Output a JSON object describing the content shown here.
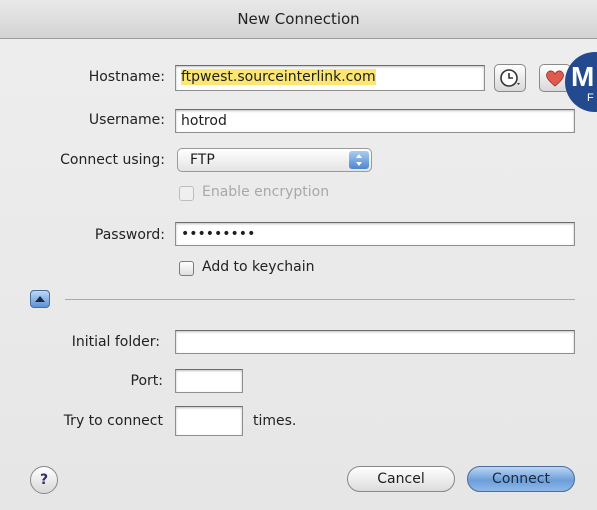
{
  "window": {
    "title": "New Connection"
  },
  "form": {
    "hostname_label": "Hostname:",
    "hostname_value": "ftpwest.sourceinterlink.com",
    "username_label": "Username:",
    "username_value": "hotrod",
    "connect_label": "Connect using:",
    "connect_value": "FTP",
    "encryption_label": "Enable encryption",
    "password_label": "Password:",
    "password_value": "•••••••••",
    "keychain_label": "Add to keychain",
    "initial_folder_label": "Initial folder:",
    "initial_folder_value": "",
    "port_label": "Port:",
    "port_value": "",
    "try_label": "Try to connect",
    "try_value": "",
    "times_label": "times."
  },
  "buttons": {
    "cancel": "Cancel",
    "connect": "Connect",
    "help": "?"
  },
  "badge": {
    "letter": "M",
    "sub": "F"
  },
  "icons": {
    "history": "clock-icon",
    "favorite": "heart-icon",
    "disclosure": "triangle-up-icon",
    "popup": "up-down-arrows-icon"
  },
  "colors": {
    "highlight": "#fbe673",
    "default_button": "#6d9ed9",
    "heart": "#e05a4f"
  }
}
